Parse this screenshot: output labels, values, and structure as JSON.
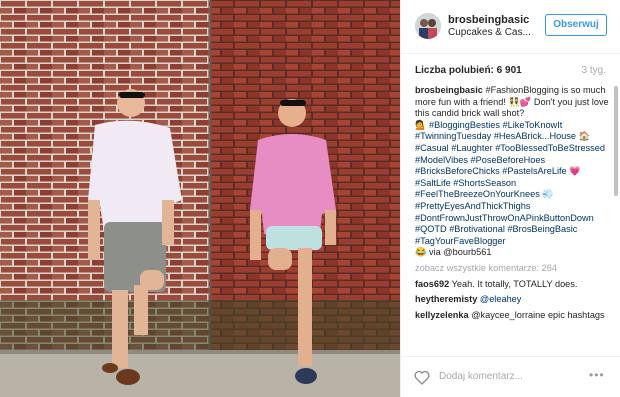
{
  "post": {
    "username": "brosbeingbasic",
    "location": "Cupcakes & Cas...",
    "follow_label": "Obserwuj",
    "likes_label": "Liczba polubień: 6 901",
    "date": "3 tyg."
  },
  "caption": {
    "user": "brosbeingbasic",
    "lines": [
      "#FashionBlogging is so much more fun with a friend! 👯💕 Don't you just love this candid brick wall shot?",
      "💁 #BloggingBesties #LikeToKnowIt #TwinningTuesday #HesABrick...House 🏠 #Casual #Laughter #TooBlessedToBeStressed #ModelVibes #PoseBeforeHoes #BricksBeforeChicks #PastelsAreLife 💗 #SaltLife #ShortsSeason #FeelTheBreezeOnYourKnees 💨 #PrettyEyesAndThickThighs #DontFrownJustThrowOnAPinkButtonDown #QOTD #Brotivational #BrosBeingBasic #TagYourFaveBlogger",
      "😂 via @bourb561"
    ]
  },
  "comments": {
    "view_all": "zobacz wszystkie komentarze: 264",
    "items": [
      {
        "user": "faos692",
        "text": "Yeah. It totally, TOTALLY does."
      },
      {
        "user": "heytheremisty",
        "text": "@eleahey"
      },
      {
        "user": "kellyzelenka",
        "text": "@kaycee_lorraine epic hashtags"
      }
    ]
  },
  "footer": {
    "add_comment_placeholder": "Dodaj komentarz...",
    "more_label": "•••"
  },
  "icons": {
    "heart": "heart-outline-icon",
    "more": "more-options-icon"
  },
  "colors": {
    "accent": "#3897f0",
    "hashtag": "#003569",
    "muted": "#a8a8a8",
    "brick": "#8a4a3a"
  }
}
